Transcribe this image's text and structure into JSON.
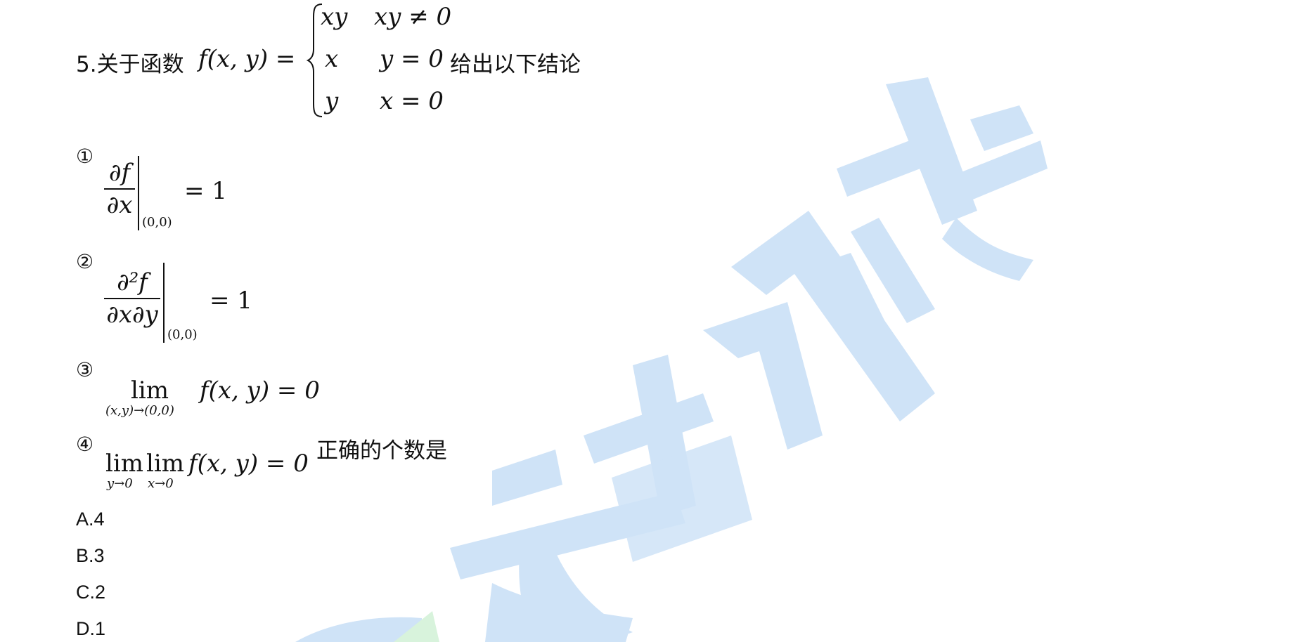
{
  "watermark": {
    "text": "文都网校",
    "color": "#cfe3f7"
  },
  "question": {
    "prefix": "5.关于函数",
    "func": "f(x, y) =",
    "cases": [
      {
        "expr": "xy",
        "cond": "xy ≠ 0"
      },
      {
        "expr": "x",
        "cond": "y = 0"
      },
      {
        "expr": "y",
        "cond": "x = 0"
      }
    ],
    "suffix": "给出以下结论"
  },
  "statements": [
    {
      "marker": "①",
      "num": "∂f",
      "den": "∂x",
      "eval": "(0,0)",
      "rhs": "= 1"
    },
    {
      "marker": "②",
      "num": "∂²f",
      "den": "∂x∂y",
      "eval": "(0,0)",
      "rhs": "= 1"
    },
    {
      "marker": "③",
      "lim": "lim",
      "limsub": "(x,y)→(0,0)",
      "expr": "f(x, y) = 0"
    },
    {
      "marker": "④",
      "lim1": "lim",
      "limsub1": "y→0",
      "lim2": "lim",
      "limsub2": "x→0",
      "expr": "f(x, y) = 0",
      "tail": "正确的个数是"
    }
  ],
  "options": [
    {
      "label": "A.4"
    },
    {
      "label": "B.3"
    },
    {
      "label": "C.2"
    },
    {
      "label": "D.1"
    }
  ]
}
